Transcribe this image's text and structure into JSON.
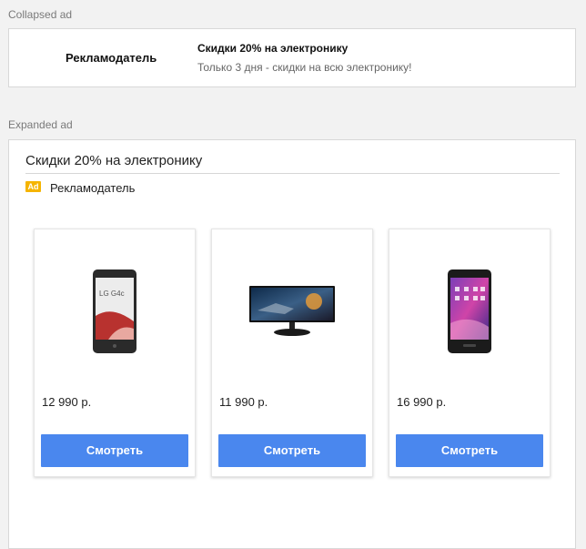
{
  "collapsed": {
    "section_label": "Collapsed ad",
    "advertiser": "Рекламодатель",
    "headline": "Скидки 20% на электронику",
    "description": "Только 3 дня - скидки на всю электронику!"
  },
  "expanded": {
    "section_label": "Expanded ad",
    "title": "Скидки 20% на электронику",
    "badge": "Ad",
    "advertiser": "Рекламодатель",
    "products": [
      {
        "image": "smartphone-lg-g4c-image",
        "price": "12 990 р.",
        "button_label": "Смотреть"
      },
      {
        "image": "monitor-image",
        "price": "11 990 р.",
        "button_label": "Смотреть"
      },
      {
        "image": "smartphone-asus-image",
        "price": "16 990 р.",
        "button_label": "Смотреть"
      }
    ]
  },
  "colors": {
    "page_bg": "#f2f2f2",
    "button": "#4a87ee",
    "badge": "#f5b400"
  }
}
